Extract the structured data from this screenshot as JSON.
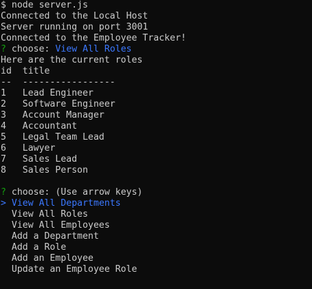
{
  "colors": {
    "background": "#0c0c0c",
    "text": "#cccccc",
    "prompt_mark": "#13a10e",
    "highlight": "#3b78ff"
  },
  "output": {
    "command": "$ node server.js",
    "connected_local": "Connected to the Local Host",
    "server_running": "Server running on port 3001",
    "connected_tracker": "Connected to the Employee Tracker!",
    "first_prompt": {
      "mark": "?",
      "question": "choose:",
      "answer": "View All Roles"
    },
    "roles_heading": "Here are the current roles",
    "table": {
      "header": "id  title",
      "separator": "--  -----------------",
      "rows": [
        "1   Lead Engineer",
        "2   Software Engineer",
        "3   Account Manager",
        "4   Accountant",
        "5   Legal Team Lead",
        "6   Lawyer",
        "7   Sales Lead",
        "8   Sales Person"
      ]
    },
    "second_prompt": {
      "mark": "?",
      "question": "choose:",
      "hint": "(Use arrow keys)"
    },
    "menu": {
      "pointer": ">",
      "selected": "View All Departments",
      "items": [
        "View All Roles",
        "View All Employees",
        "Add a Department",
        "Add a Role",
        "Add an Employee",
        "Update an Employee Role"
      ]
    }
  }
}
